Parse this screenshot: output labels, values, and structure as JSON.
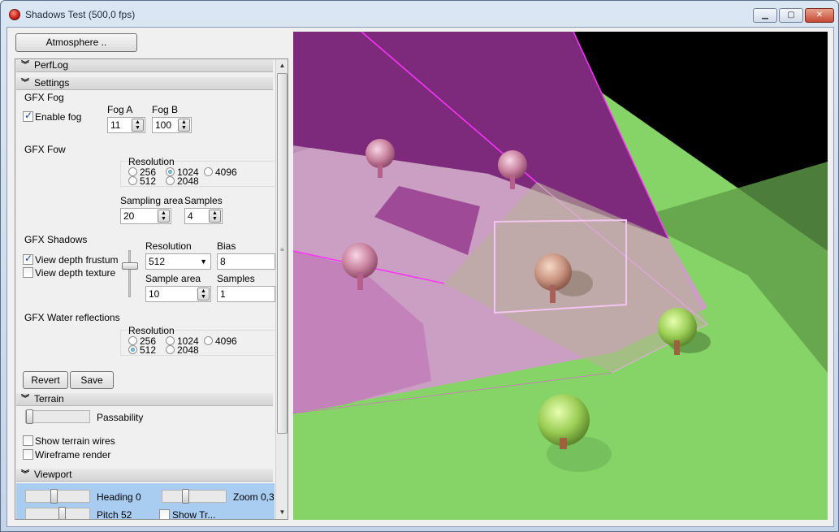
{
  "window": {
    "title": "Shadows Test (500,0 fps)"
  },
  "toolbar": {
    "atmosphere_label": "Atmosphere .."
  },
  "sections": {
    "perflog": "PerfLog",
    "settings": "Settings",
    "terrain": "Terrain",
    "viewport": "Viewport"
  },
  "fog": {
    "group_title": "GFX Fog",
    "enable_label": "Enable fog",
    "enable_checked": true,
    "fog_a_label": "Fog A",
    "fog_a_value": "11",
    "fog_b_label": "Fog B",
    "fog_b_value": "100"
  },
  "fow": {
    "group_title": "GFX Fow",
    "resolution_label": "Resolution",
    "res_options": [
      "256",
      "1024",
      "4096",
      "512",
      "2048"
    ],
    "res_selected": "1024",
    "sampling_area_label": "Sampling area",
    "sampling_area_value": "20",
    "samples_label": "Samples",
    "samples_value": "4"
  },
  "shadows": {
    "group_title": "GFX Shadows",
    "view_frustum_label": "View depth frustum",
    "view_frustum_checked": true,
    "view_texture_label": "View depth texture",
    "view_texture_checked": false,
    "resolution_label": "Resolution",
    "resolution_value": "512",
    "bias_label": "Bias",
    "bias_value": "8",
    "sample_area_label": "Sample area",
    "sample_area_value": "10",
    "samples_label": "Samples",
    "samples_value": "1"
  },
  "water": {
    "group_title": "GFX Water reflections",
    "resolution_label": "Resolution",
    "res_options": [
      "256",
      "1024",
      "4096",
      "512",
      "2048"
    ],
    "res_selected": "512"
  },
  "buttons": {
    "revert": "Revert",
    "save": "Save"
  },
  "terrain": {
    "passability_label": "Passability",
    "show_wires_label": "Show terrain wires",
    "wireframe_label": "Wireframe render"
  },
  "viewport": {
    "heading_label": "Heading 0",
    "zoom_label": "Zoom 0,3",
    "pitch_label": "Pitch 52",
    "show_label": "Show Tr..."
  },
  "colors": {
    "frustum": "#ff33ff",
    "shadow_region": "#7a1f7a",
    "grass": "#8cdc6e",
    "selection": "#a9cdf1"
  }
}
